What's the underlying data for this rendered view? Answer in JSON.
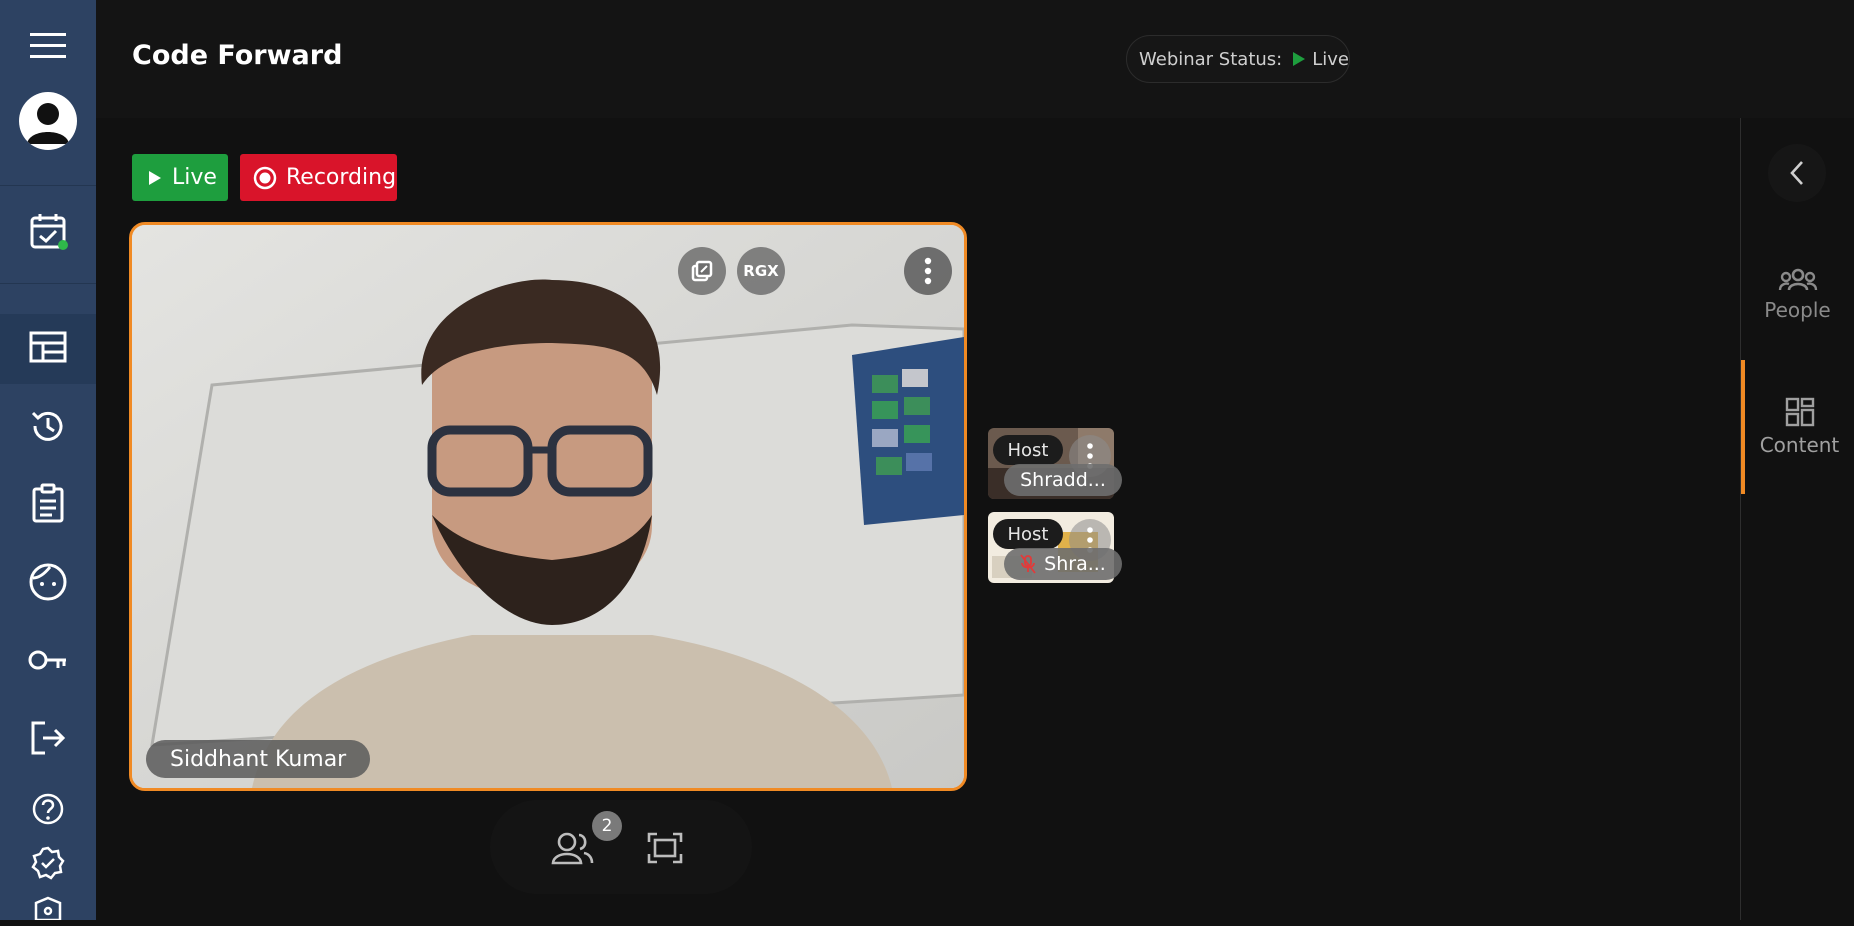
{
  "app": {
    "title": "Code Forward"
  },
  "webinar": {
    "status_label": "Webinar Status:",
    "status_value": "Live"
  },
  "badges": {
    "live": "Live",
    "recording": "Recording"
  },
  "main_video": {
    "participant_name": "Siddhant Kumar",
    "rgx_label": "RGX"
  },
  "thumbnails": [
    {
      "role": "Host",
      "name": "Shradd...",
      "muted": false
    },
    {
      "role": "Host",
      "name": "Shra...",
      "muted": true
    }
  ],
  "controls": {
    "participant_count": "2"
  },
  "right_panel": {
    "tabs": [
      {
        "label": "People",
        "icon": "people-icon"
      },
      {
        "label": "Content",
        "icon": "grid-icon"
      }
    ]
  },
  "colors": {
    "sidebar": "#2d4262",
    "accent": "#f08a24",
    "live_green": "#1e9e3e",
    "recording_red": "#d9142a"
  }
}
